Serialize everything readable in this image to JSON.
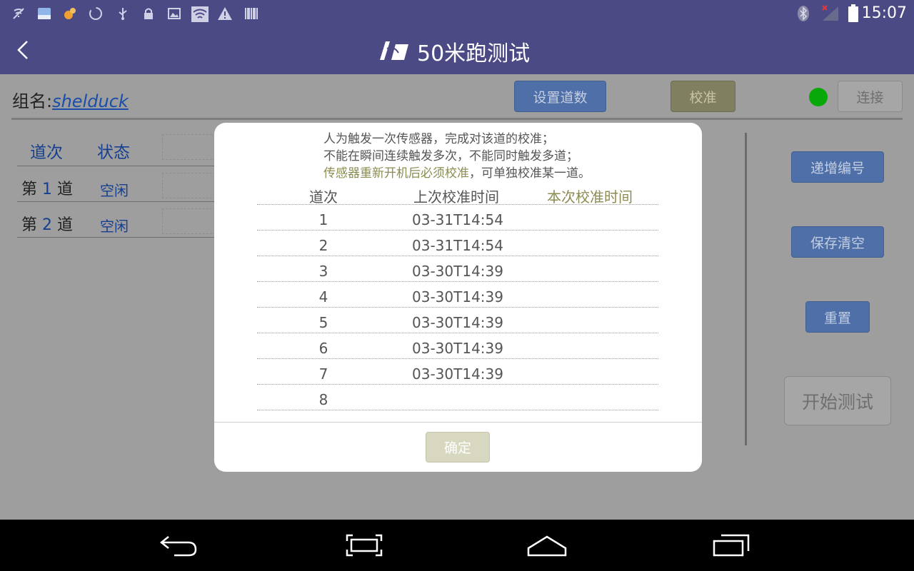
{
  "status_bar": {
    "time": "15:07",
    "icons_left": [
      "wireless-off-icon",
      "image-icon",
      "squirrel-icon",
      "sync-icon",
      "usb-icon",
      "lock-icon",
      "gallery-icon",
      "wifi-icon",
      "warning-icon",
      "barcode-icon"
    ],
    "icons_right": [
      "bluetooth-icon",
      "signal-icon",
      "battery-icon"
    ]
  },
  "header": {
    "title": "50米跑测试",
    "bg_color": "#4b4a85"
  },
  "main": {
    "group_label": "组名:",
    "group_value": "shelduck",
    "set_lanes_button": "设置道数",
    "calibrate_button": "校准",
    "connect_button": "连接",
    "connection_status_color": "#08a808",
    "columns": [
      "道次",
      "状态"
    ],
    "lanes": [
      {
        "prefix": "第",
        "num": "1",
        "suffix": "道",
        "status": "空闲"
      },
      {
        "prefix": "第",
        "num": "2",
        "suffix": "道",
        "status": "空闲"
      }
    ],
    "increment_button": "递增编号",
    "save_clear_button": "保存清空",
    "reset_button": "重置",
    "start_test_button": "开始测试"
  },
  "dialog": {
    "info_line1": "人为触发一次传感器，完成对该道的校准；",
    "info_line2": "不能在瞬间连续触发多次，不能同时触发多道；",
    "info_line3_highlight": "传感器重新开机后必须校准",
    "info_line3_rest": "，可单独校准某一道。",
    "headers": [
      "道次",
      "上次校准时间",
      "本次校准时间"
    ],
    "rows": [
      {
        "lane": "1",
        "last": "03-31T14:54",
        "current": ""
      },
      {
        "lane": "2",
        "last": "03-31T14:54",
        "current": ""
      },
      {
        "lane": "3",
        "last": "03-30T14:39",
        "current": ""
      },
      {
        "lane": "4",
        "last": "03-30T14:39",
        "current": ""
      },
      {
        "lane": "5",
        "last": "03-30T14:39",
        "current": ""
      },
      {
        "lane": "6",
        "last": "03-30T14:39",
        "current": ""
      },
      {
        "lane": "7",
        "last": "03-30T14:39",
        "current": ""
      },
      {
        "lane": "8",
        "last": "",
        "current": ""
      }
    ],
    "ok_button": "确定"
  },
  "nav_bar": {
    "icons": [
      "back-icon",
      "screenshot-icon",
      "home-icon",
      "recents-icon"
    ]
  }
}
